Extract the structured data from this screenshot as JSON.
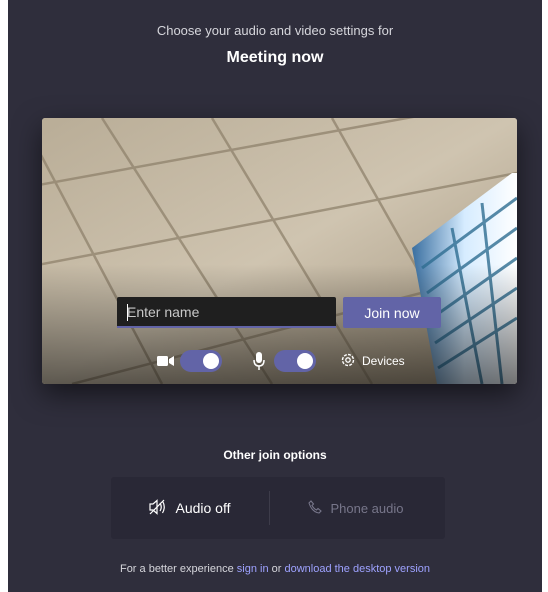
{
  "header": {
    "subtitle": "Choose your audio and video settings for",
    "meeting_title": "Meeting now"
  },
  "preview": {
    "name_input": {
      "value": "",
      "placeholder": "Enter name"
    },
    "join_button_label": "Join now",
    "camera_toggle": {
      "icon": "video-camera-icon",
      "on": true
    },
    "mic_toggle": {
      "icon": "microphone-icon",
      "on": true
    },
    "devices_label": "Devices",
    "devices_icon": "gear-icon"
  },
  "other_options": {
    "title": "Other join options",
    "audio_off_label": "Audio off",
    "audio_off_icon": "speaker-off-icon",
    "phone_audio_label": "Phone audio",
    "phone_audio_icon": "phone-icon"
  },
  "footer": {
    "prefix": "For a better experience",
    "sign_in_link": "sign in",
    "middle": "or",
    "download_link": "download the desktop version"
  },
  "colors": {
    "background": "#2f2e3c",
    "accent": "#6264a7",
    "link": "#9ea2ff"
  }
}
